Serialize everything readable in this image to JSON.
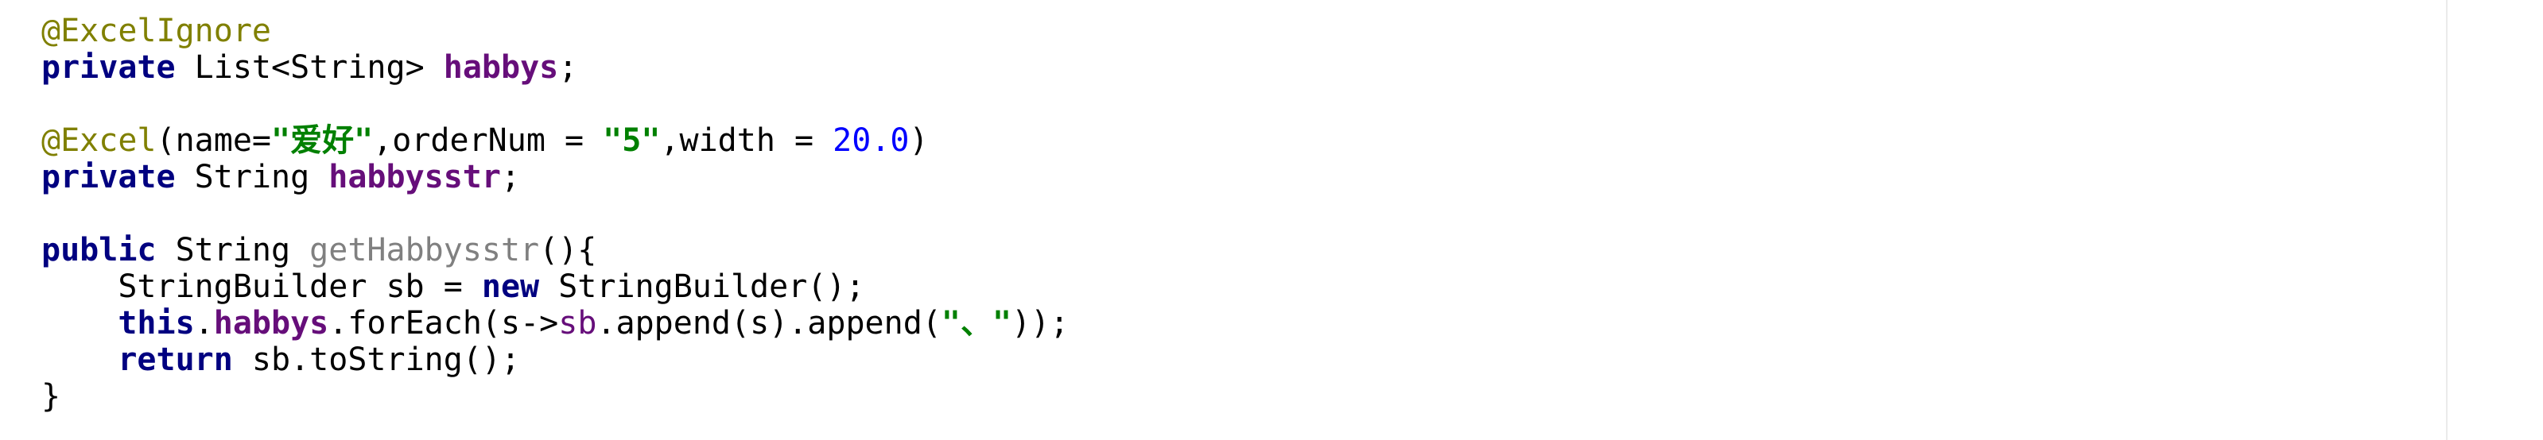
{
  "editor": {
    "colors": {
      "background": "#ffffff",
      "keyword": "#000080",
      "annotation": "#808000",
      "field": "#660e7a",
      "string": "#008000",
      "number": "#0000ff",
      "unused_method": "#808080",
      "default_text": "#000000",
      "right_margin": "#ebebeb"
    },
    "lines": [
      {
        "tokens": [
          {
            "text": "@ExcelIgnore",
            "type": "anno"
          }
        ]
      },
      {
        "tokens": [
          {
            "text": "private",
            "type": "kw"
          },
          {
            "text": " List<String> ",
            "type": "plain"
          },
          {
            "text": "habbys",
            "type": "field"
          },
          {
            "text": ";",
            "type": "plain"
          }
        ]
      },
      {
        "tokens": []
      },
      {
        "tokens": [
          {
            "text": "@Excel",
            "type": "anno"
          },
          {
            "text": "(name=",
            "type": "plain"
          },
          {
            "text": "\"爱好\"",
            "type": "str"
          },
          {
            "text": ",orderNum = ",
            "type": "plain"
          },
          {
            "text": "\"5\"",
            "type": "str"
          },
          {
            "text": ",width = ",
            "type": "plain"
          },
          {
            "text": "20.0",
            "type": "num"
          },
          {
            "text": ")",
            "type": "plain"
          }
        ]
      },
      {
        "tokens": [
          {
            "text": "private",
            "type": "kw"
          },
          {
            "text": " String ",
            "type": "plain"
          },
          {
            "text": "habbysstr",
            "type": "field"
          },
          {
            "text": ";",
            "type": "plain"
          }
        ]
      },
      {
        "tokens": []
      },
      {
        "tokens": [
          {
            "text": "public",
            "type": "kw"
          },
          {
            "text": " String ",
            "type": "plain"
          },
          {
            "text": "getHabbysstr",
            "type": "unused"
          },
          {
            "text": "(){",
            "type": "plain"
          }
        ]
      },
      {
        "tokens": [
          {
            "text": "    StringBuilder sb = ",
            "type": "plain"
          },
          {
            "text": "new",
            "type": "kw"
          },
          {
            "text": " StringBuilder();",
            "type": "plain"
          }
        ]
      },
      {
        "tokens": [
          {
            "text": "    ",
            "type": "plain"
          },
          {
            "text": "this",
            "type": "kw"
          },
          {
            "text": ".",
            "type": "plain"
          },
          {
            "text": "habbys",
            "type": "field"
          },
          {
            "text": ".forEach(s->",
            "type": "plain"
          },
          {
            "text": "sb",
            "type": "field-plain"
          },
          {
            "text": ".append(s).append(",
            "type": "plain"
          },
          {
            "text": "\"、\"",
            "type": "str"
          },
          {
            "text": "));",
            "type": "plain"
          }
        ]
      },
      {
        "tokens": [
          {
            "text": "    ",
            "type": "plain"
          },
          {
            "text": "return",
            "type": "kw"
          },
          {
            "text": " sb.toString();",
            "type": "plain"
          }
        ]
      },
      {
        "tokens": [
          {
            "text": "}",
            "type": "plain"
          }
        ]
      }
    ]
  }
}
